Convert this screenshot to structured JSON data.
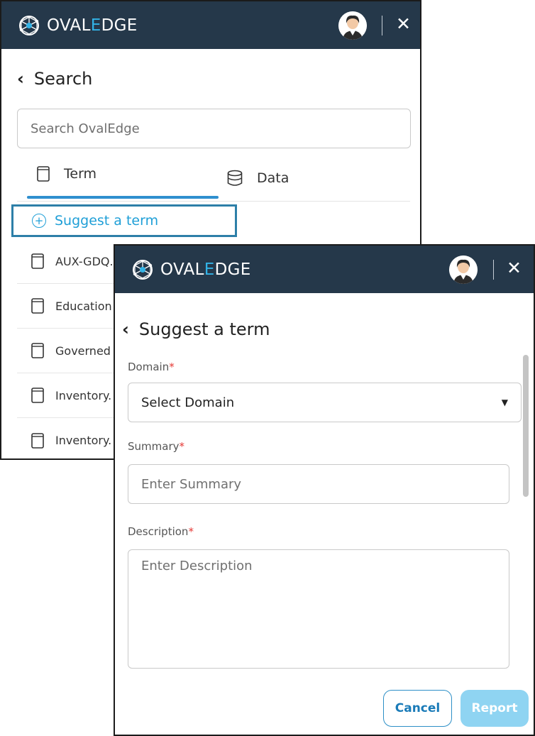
{
  "colors": {
    "header_bg": "#25384a",
    "accent": "#1f9fd7",
    "logo_e": "#33b3e6",
    "required": "#e53935",
    "report_btn": "#8fd4f2"
  },
  "logo": {
    "prefix": "OVAL",
    "e": "E",
    "suffix": "DGE"
  },
  "back_panel": {
    "title": "Search",
    "search_placeholder": "Search OvalEdge",
    "tabs": [
      {
        "label": "Term",
        "icon": "book-icon"
      },
      {
        "label": "Data",
        "icon": "database-icon"
      }
    ],
    "suggest_link": "Suggest a term",
    "terms": [
      "AUX-GDQ.",
      "Education",
      "Governed",
      "Inventory.",
      "Inventory."
    ]
  },
  "front_panel": {
    "title": "Suggest a term",
    "domain_label": "Domain",
    "domain_value": "Select Domain",
    "summary_label": "Summary",
    "summary_placeholder": "Enter Summary",
    "description_label": "Description",
    "description_placeholder": "Enter Description",
    "required_mark": "*",
    "cancel_label": "Cancel",
    "report_label": "Report"
  }
}
